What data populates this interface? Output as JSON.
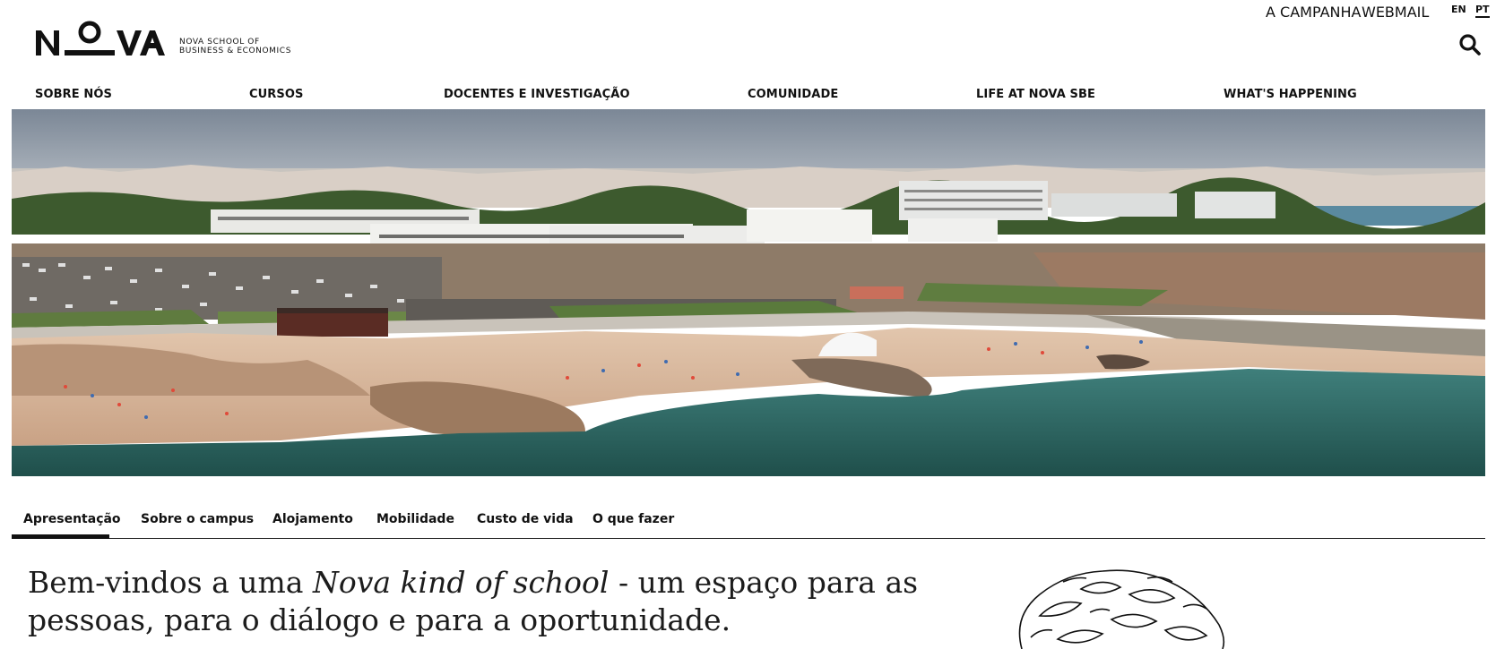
{
  "header": {
    "logo": {
      "wordmark": "NOVA",
      "school_line1": "NOVA SCHOOL OF",
      "school_line2": "BUSINESS & ECONOMICS"
    },
    "top_links": [
      "A CAMPANHA",
      "WEBMAIL"
    ],
    "languages": [
      {
        "label": "EN",
        "active": false
      },
      {
        "label": "PT",
        "active": true
      }
    ],
    "search_icon": "search-icon"
  },
  "main_nav": [
    "SOBRE NÓS",
    "CURSOS",
    "DOCENTES E INVESTIGAÇÃO",
    "COMUNIDADE",
    "LIFE AT NOVA SBE",
    "WHAT'S HAPPENING"
  ],
  "subnav": {
    "tabs": [
      "Apresentação",
      "Sobre o campus",
      "Alojamento",
      "Mobilidade",
      "Custo de vida",
      "O que fazer"
    ],
    "active_index": 0
  },
  "intro": {
    "text_before": "Bem-vindos a uma ",
    "text_italic": "Nova kind of school",
    "text_after": " - um espaço para as pessoas, para o diálogo e para a oportunidade."
  },
  "colors": {
    "text": "#111111",
    "sky": "#8c97a4",
    "sea": "#2f6b63",
    "sand": "#d8b79c",
    "grass": "#5f7b3f"
  }
}
